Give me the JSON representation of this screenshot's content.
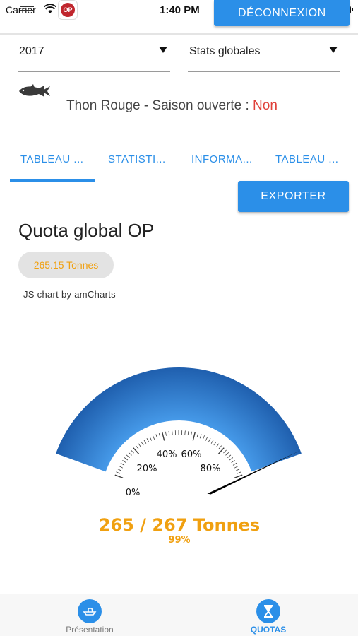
{
  "status_bar": {
    "carrier": "Carrier",
    "time": "1:40 PM",
    "app_badge": "OP"
  },
  "header": {
    "logout_label": "DÉCONNEXION"
  },
  "filters": {
    "year": "2017",
    "stats": "Stats globales"
  },
  "species": {
    "name": "Thon Rouge - Saison ouverte : ",
    "open_status": "Non",
    "open_status_color": "#e0413a"
  },
  "tabs": [
    {
      "label": "TABLEAU ...",
      "active": true
    },
    {
      "label": "STATISTI...",
      "active": false
    },
    {
      "label": "INFORMA...",
      "active": false
    },
    {
      "label": "TABLEAU ...",
      "active": false
    }
  ],
  "toolbar": {
    "export_label": "EXPORTER"
  },
  "quota": {
    "title": "Quota global OP",
    "chip_value": "265.15 Tonnes",
    "chart_credit": "JS chart by amCharts"
  },
  "gauge": {
    "value_text": "265 / 267 Tonnes",
    "percent_text": "99%",
    "percent": 99,
    "tick_labels": [
      "0%",
      "20%",
      "40%",
      "60%",
      "80%"
    ],
    "accent_color": "#f0a010",
    "band_color": "#2b7bd1"
  },
  "bottom_nav": [
    {
      "label": "Présentation",
      "icon": "boat-icon",
      "active": false
    },
    {
      "label": "QUOTAS",
      "icon": "hourglass-icon",
      "active": true
    }
  ],
  "colors": {
    "primary": "#2b8fe8",
    "accent": "#f0a010"
  }
}
